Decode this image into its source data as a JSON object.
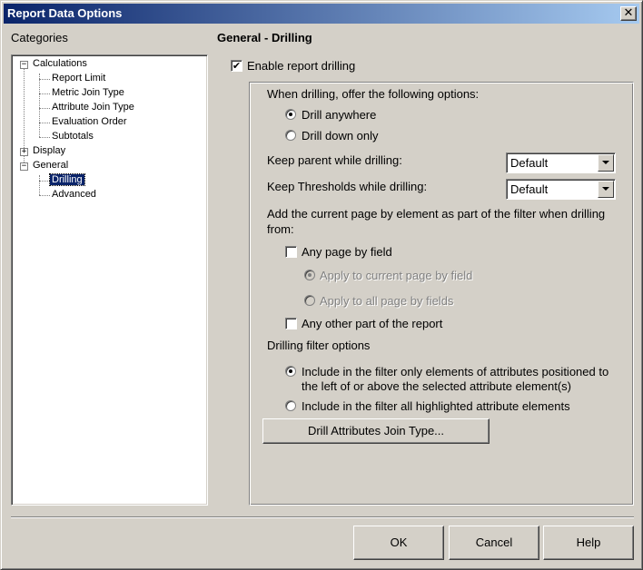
{
  "window": {
    "title": "Report Data Options",
    "close_glyph": "✕"
  },
  "sidebar": {
    "label": "Categories",
    "tree": [
      {
        "label": "Calculations",
        "expander": "−",
        "children": [
          "Report Limit",
          "Metric Join Type",
          "Attribute Join Type",
          "Evaluation Order",
          "Subtotals"
        ]
      },
      {
        "label": "Display",
        "expander": "+"
      },
      {
        "label": "General",
        "expander": "−",
        "children": [
          "Drilling",
          "Advanced"
        ]
      }
    ],
    "selected": "Drilling"
  },
  "panel": {
    "heading": "General - Drilling",
    "enable_drilling": {
      "label": "Enable report drilling",
      "checked": true
    },
    "offer_label": "When drilling, offer the following options:",
    "drill_options": [
      {
        "label": "Drill anywhere",
        "selected": true
      },
      {
        "label": "Drill down only",
        "selected": false
      }
    ],
    "keep_parent": {
      "label": "Keep parent while drilling:",
      "value": "Default"
    },
    "keep_thresholds": {
      "label": "Keep Thresholds while drilling:",
      "value": "Default"
    },
    "page_by_label": "Add the current page by element as part of the filter when drilling from:",
    "any_page_by_field": {
      "label": "Any page by field",
      "checked": false
    },
    "page_by_options": [
      {
        "label": "Apply to current page by field",
        "selected": true,
        "disabled": true
      },
      {
        "label": "Apply to all page by fields",
        "selected": false,
        "disabled": true
      }
    ],
    "any_other_part": {
      "label": "Any other part of the report",
      "checked": false
    },
    "filter_options_label": "Drilling filter options",
    "filter_options": [
      {
        "label": "Include in the filter only elements of attributes positioned to the left of or above the selected attribute element(s)",
        "selected": true
      },
      {
        "label": "Include in the filter all highlighted attribute elements",
        "selected": false
      }
    ],
    "join_type_button": "Drill Attributes Join Type..."
  },
  "footer": {
    "ok": "OK",
    "cancel": "Cancel",
    "help": "Help"
  },
  "colors": {
    "face": "#d4d0c8",
    "title_start": "#0a246a",
    "title_end": "#a6caf0",
    "selection": "#0a246a"
  }
}
